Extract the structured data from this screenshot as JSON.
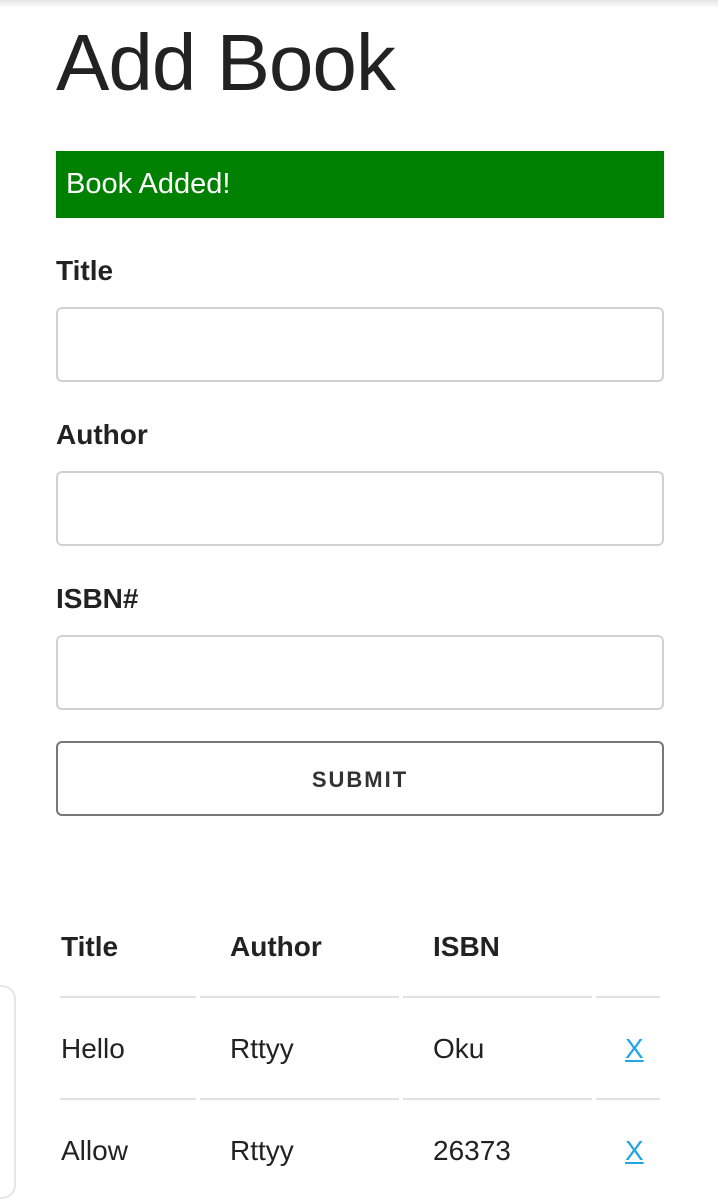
{
  "page": {
    "title": "Add Book",
    "alert_message": "Book Added!",
    "alert_color": "#008000"
  },
  "form": {
    "title_label": "Title",
    "title_value": "",
    "author_label": "Author",
    "author_value": "",
    "isbn_label": "ISBN#",
    "isbn_value": "",
    "submit_label": "SUBMIT"
  },
  "table": {
    "headers": [
      "Title",
      "Author",
      "ISBN",
      ""
    ],
    "rows": [
      {
        "title": "Hello",
        "author": "Rttyy",
        "isbn": "Oku",
        "action": "X"
      },
      {
        "title": "Allow",
        "author": "Rttyy",
        "isbn": "26373",
        "action": "X"
      }
    ],
    "link_color": "#1ea7e5"
  }
}
